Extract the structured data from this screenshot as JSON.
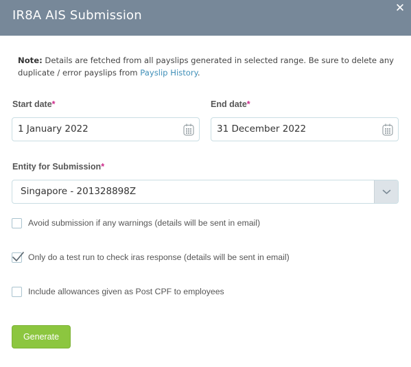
{
  "dialog": {
    "title": "IR8A AIS Submission",
    "close_symbol": "✕"
  },
  "note": {
    "prefix": "Note:",
    "text": " Details are fetched from all payslips generated in selected range. Be sure to delete any duplicate / error payslips from ",
    "link": "Payslip History",
    "suffix": "."
  },
  "start_date": {
    "label": "Start date",
    "required": "*",
    "value": "1 January 2022",
    "icon": "calendar-icon"
  },
  "end_date": {
    "label": "End date",
    "required": "*",
    "value": "31 December 2022",
    "icon": "calendar-icon"
  },
  "entity": {
    "label": "Entity for Submission",
    "required": "*",
    "value": "Singapore - 201328898Z",
    "icon": "chevron-down-icon"
  },
  "options": [
    {
      "label": "Avoid submission if any warnings (details will be sent in email)",
      "checked": false
    },
    {
      "label": "Only do a test run to check iras response (details will be sent in email)",
      "checked": true
    },
    {
      "label": "Include allowances given as Post CPF to employees",
      "checked": false
    }
  ],
  "generate_label": "Generate",
  "colors": {
    "header": "#778899",
    "accent_link": "#3f8fb8",
    "required": "#cc2a8a",
    "button": "#8cc63f"
  }
}
